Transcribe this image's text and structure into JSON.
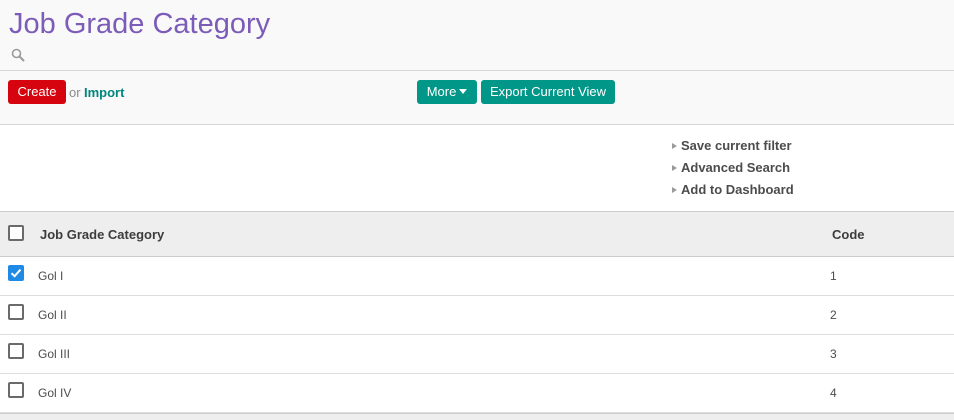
{
  "page": {
    "title": "Job Grade Category"
  },
  "search": {
    "placeholder": "",
    "value": ""
  },
  "toolbar": {
    "create_label": "Create",
    "or_label": "or",
    "import_label": "Import",
    "more_label": "More",
    "export_label": "Export Current View"
  },
  "filters": {
    "items": [
      "Save current filter",
      "Advanced Search",
      "Add to Dashboard"
    ]
  },
  "table": {
    "columns": [
      "Job Grade Category",
      "Code"
    ],
    "rows": [
      {
        "name": "Gol I",
        "code": "1",
        "checked": true
      },
      {
        "name": "Gol II",
        "code": "2",
        "checked": false
      },
      {
        "name": "Gol III",
        "code": "3",
        "checked": false
      },
      {
        "name": "Gol IV",
        "code": "4",
        "checked": false
      }
    ]
  },
  "colors": {
    "title": "#7c5cb8",
    "create_button": "#d6040f",
    "action_button": "#009688",
    "link": "#00867d",
    "checkbox_checked": "#1f8ae6"
  },
  "icons": {
    "search": "search-icon",
    "more": "caret-down-icon",
    "filter_bullet": "triangle-right-icon",
    "checkbox_checked": "check-icon"
  }
}
